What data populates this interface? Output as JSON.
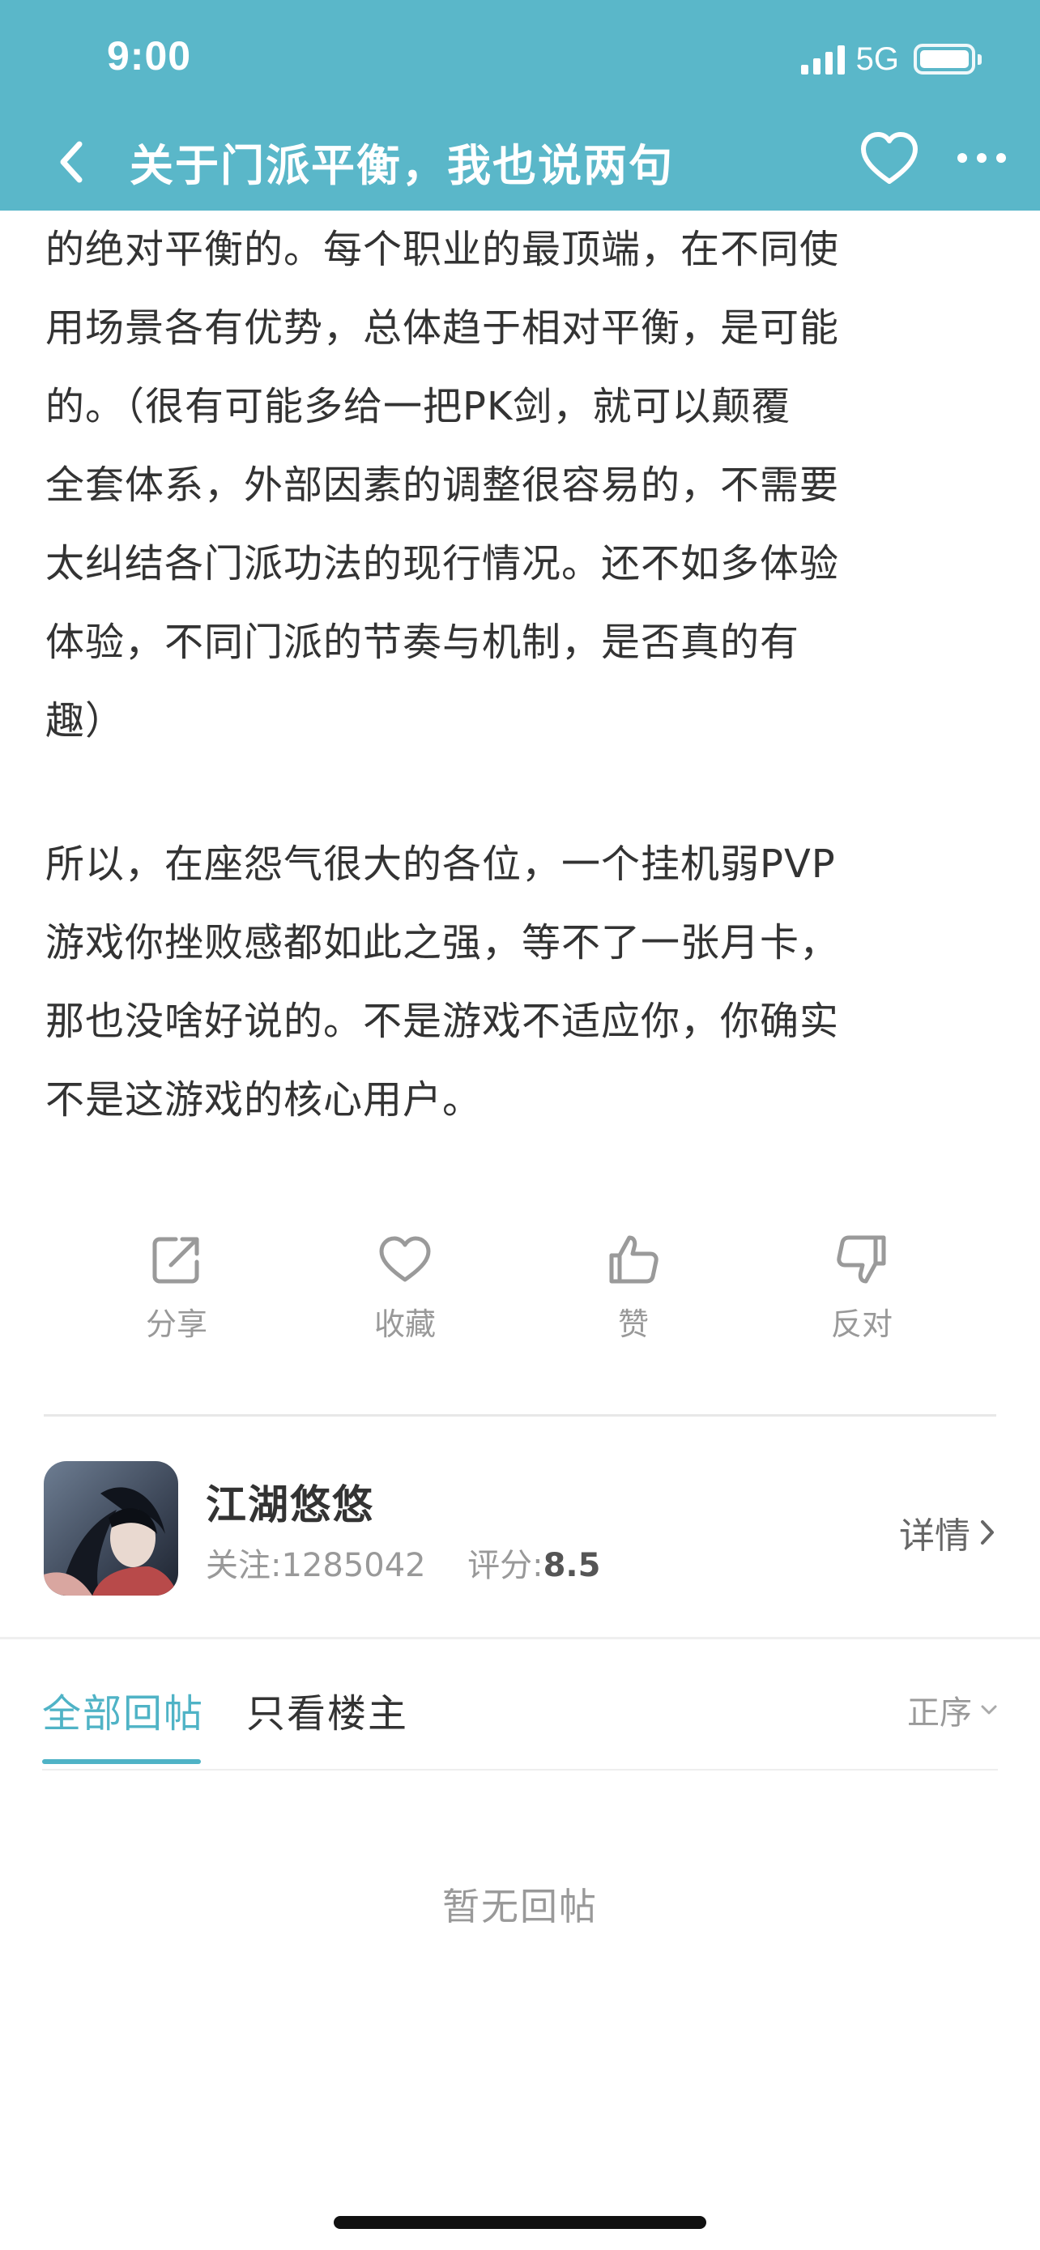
{
  "status_bar": {
    "time": "9:00",
    "network": "5G",
    "icons": [
      "signal-icon",
      "battery-icon"
    ]
  },
  "nav": {
    "title": "关于门派平衡，我也说两句",
    "icons": [
      "back-icon",
      "heart-icon",
      "more-icon"
    ]
  },
  "article": {
    "paragraphs": [
      [
        "的绝对平衡的。每个职业的最顶端，在不同使",
        "用场景各有优势，总体趋于相对平衡，是可能",
        "的。（很有可能多给一把PK剑，就可以颠覆",
        "全套体系，外部因素的调整很容易的，不需要",
        "太纠结各门派功法的现行情况。还不如多体验",
        "体验，不同门派的节奏与机制，是否真的有",
        "趣）"
      ],
      [
        "所以，在座怨气很大的各位，一个挂机弱PVP",
        "游戏你挫败感都如此之强，等不了一张月卡，",
        "那也没啥好说的。不是游戏不适应你，你确实",
        "不是这游戏的核心用户。"
      ]
    ]
  },
  "actions": {
    "share": "分享",
    "favorite": "收藏",
    "like": "赞",
    "dislike": "反对"
  },
  "game": {
    "name": "江湖悠悠",
    "followers_label": "关注:",
    "followers": "1285042",
    "rating_label": "评分:",
    "rating": "8.5",
    "detail_label": "详情"
  },
  "tabs": {
    "all_replies": "全部回帖",
    "op_only": "只看楼主",
    "sort": "正序"
  },
  "replies": {
    "empty_text": "暂无回帖"
  },
  "colors": {
    "header_bg": "#5ab7c9",
    "accent": "#4fb3c6",
    "body_text": "#333333",
    "muted_text": "#999999"
  }
}
